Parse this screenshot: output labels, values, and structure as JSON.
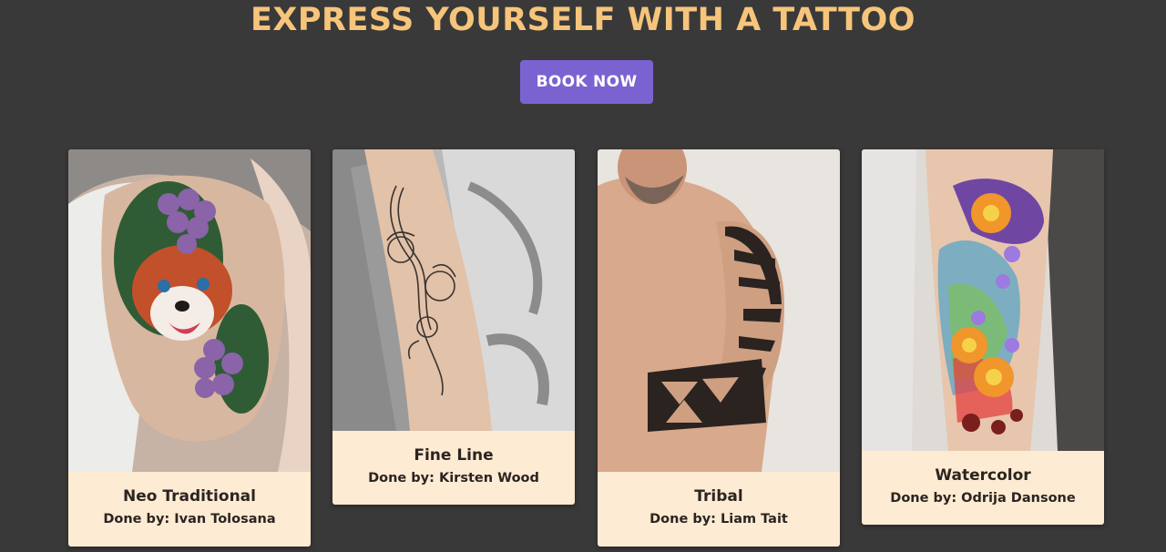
{
  "page": {
    "headline": "EXPRESS YOURSELF WITH A TATTOO",
    "book_button": "BOOK NOW"
  },
  "gallery": [
    {
      "style": "Neo Traditional",
      "artist_prefix": "Done by:",
      "artist": "Ivan Tolosana",
      "credit": "Done by: Ivan Tolosana"
    },
    {
      "style": "Fine Line",
      "artist_prefix": "Done by:",
      "artist": "Kirsten Wood",
      "credit": "Done by: Kirsten Wood"
    },
    {
      "style": "Tribal",
      "artist_prefix": "Done by:",
      "artist": "Liam Tait",
      "credit": "Done by: Liam Tait"
    },
    {
      "style": "Watercolor",
      "artist_prefix": "Done by:",
      "artist": "Odrija Dansone",
      "credit": "Done by: Odrija Dansone"
    }
  ],
  "colors": {
    "background": "#3a3939",
    "headline": "#f6c57b",
    "button": "#7a63d1",
    "caption_bg": "#fdebd3"
  }
}
